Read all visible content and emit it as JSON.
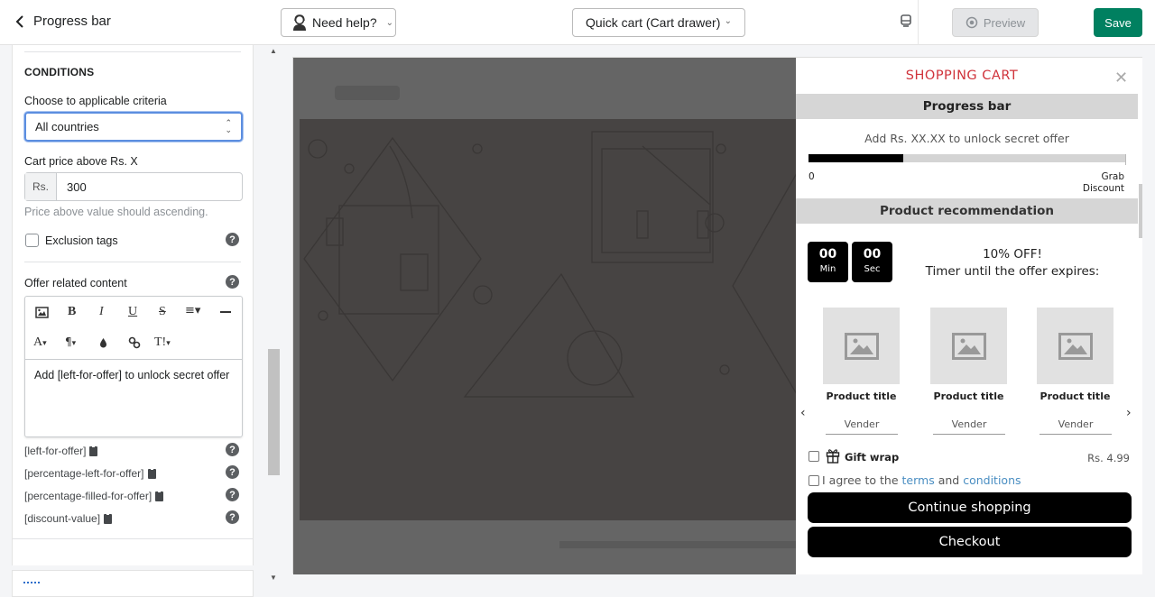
{
  "header": {
    "title": "Progress bar",
    "help_label": "Need help?",
    "template_select": "Quick cart (Cart drawer)",
    "preview_label": "Preview",
    "save_label": "Save",
    "colors": {
      "save": "#008060",
      "accent": "#5c8ee0"
    }
  },
  "sidebar": {
    "section_title": "CONDITIONS",
    "criteria_label": "Choose to applicable criteria",
    "criteria_value": "All countries",
    "price_label": "Cart price above Rs. X",
    "price_prefix": "Rs.",
    "price_value": "300",
    "price_hint": "Price above value should ascending.",
    "exclusion_label": "Exclusion tags",
    "exclusion_checked": false,
    "offer_content_label": "Offer related content",
    "editor_toolbar": [
      "image",
      "bold",
      "italic",
      "underline",
      "strikethrough",
      "align",
      "horizontal-rule",
      "font-color",
      "paragraph",
      "fill-color",
      "link",
      "text-size"
    ],
    "editor_text": "Add [left-for-offer] to unlock secret offer",
    "variables": [
      "[left-for-offer]",
      "[percentage-left-for-offer]",
      "[percentage-filled-for-offer]",
      "[discount-value]"
    ]
  },
  "cart": {
    "title": "SHOPPING CART",
    "title_color": "#d0333b",
    "progress_heading": "Progress bar",
    "progress_message": "Add Rs. XX.XX to unlock secret offer",
    "progress_percent": 30,
    "progress_start": "0",
    "progress_end_line1": "Grab",
    "progress_end_line2": "Discount",
    "recommendation_heading": "Product recommendation",
    "timer_minutes": "00",
    "timer_min_label": "Min",
    "timer_seconds": "00",
    "timer_sec_label": "Sec",
    "offer_line1": "10% OFF!",
    "offer_line2": "Timer until the offer expires:",
    "products": [
      {
        "title": "Product title",
        "vendor": "Vender"
      },
      {
        "title": "Product title",
        "vendor": "Vender"
      },
      {
        "title": "Product title",
        "vendor": "Vender"
      }
    ],
    "gift_wrap_label": "Gift wrap",
    "gift_wrap_price": "Rs. 4.99",
    "agree_prefix": "I agree to the",
    "agree_terms": "terms",
    "agree_and": "and",
    "agree_conditions": "conditions",
    "continue_label": "Continue shopping",
    "checkout_label": "Checkout"
  }
}
